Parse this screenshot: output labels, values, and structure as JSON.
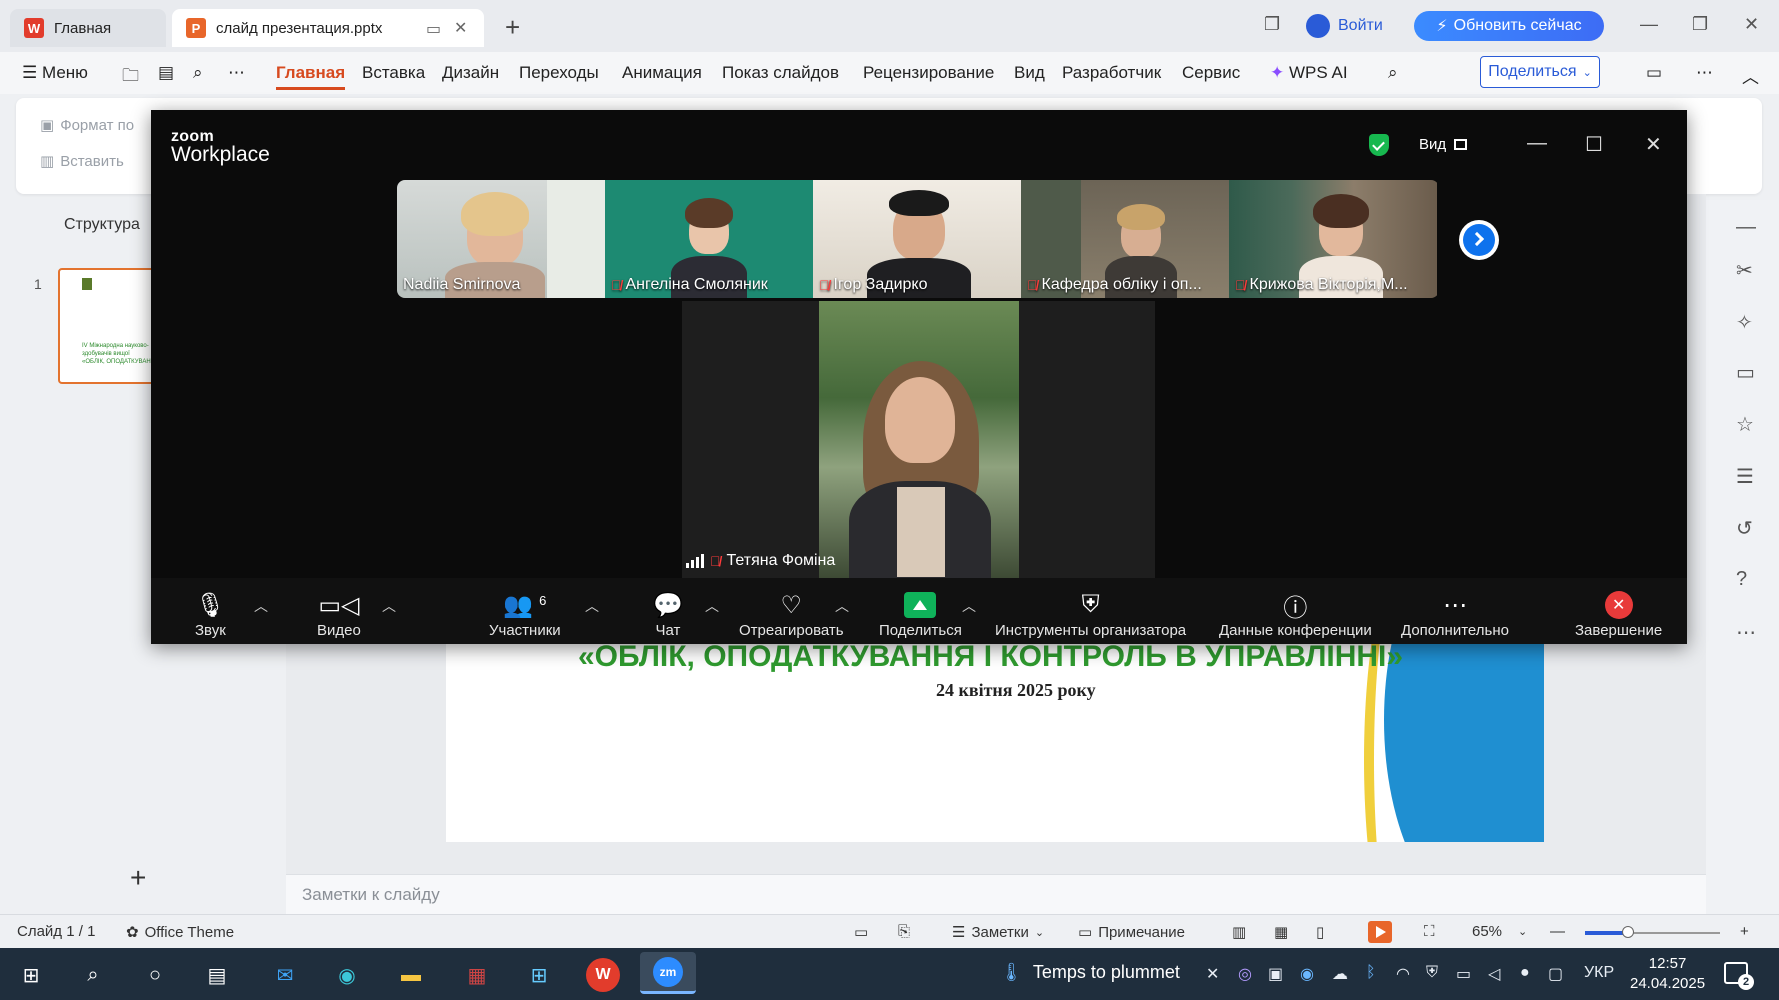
{
  "wps": {
    "tabs": [
      {
        "label": "Главная"
      },
      {
        "label": "слайд презентация.pptx"
      }
    ],
    "login": "Войти",
    "upgrade": "Обновить сейчас",
    "menu_label": "Меню",
    "menu": [
      "Главная",
      "Вставка",
      "Дизайн",
      "Переходы",
      "Анимация",
      "Показ слайдов",
      "Рецензирование",
      "Вид",
      "Разработчик",
      "Сервис",
      "WPS AI"
    ],
    "share": "Поделиться",
    "ribbon": {
      "format": "Формат по",
      "paste": "Вставить"
    },
    "structure": "Структура",
    "slide_number": "1",
    "slide": {
      "title": "«ОБЛІК, ОПОДАТКУВАННЯ І КОНТРОЛЬ В УПРАВЛІННІ»",
      "date": "24 квітня 2025 року",
      "thumb_text": "IV Міжнародна науково- здобувачів вищої «ОБЛІК, ОПОДАТКУВАН"
    },
    "notes_placeholder": "Заметки к слайду",
    "status": {
      "slide_count": "Слайд 1 / 1",
      "theme": "Office Theme",
      "notes": "Заметки",
      "comment": "Примечание",
      "zoom": "65%"
    }
  },
  "zoom": {
    "brand_top": "zoom",
    "brand_bottom": "Workplace",
    "view_label": "Вид",
    "participants": [
      {
        "name": "Nadiia Smirnova",
        "muted": false
      },
      {
        "name": "Ангеліна Смоляник",
        "muted": true
      },
      {
        "name": "Ігор Задирко",
        "muted": true
      },
      {
        "name": "Кафедра обліку і оп...",
        "muted": true
      },
      {
        "name": "Крижова Вікторія,М...",
        "muted": true
      }
    ],
    "speaker": "Тетяна Фоміна",
    "controls": {
      "audio": "Звук",
      "video": "Видео",
      "participants": "Участники",
      "participants_count": "6",
      "chat": "Чат",
      "react": "Отреагировать",
      "share": "Поделиться",
      "host_tools": "Инструменты организатора",
      "meeting_info": "Данные конференции",
      "more": "Дополнительно",
      "end": "Завершение"
    }
  },
  "taskbar": {
    "weather": "Temps to plummet",
    "lang": "УКР",
    "time": "12:57",
    "date": "24.04.2025",
    "notifications": "2"
  },
  "colors": {
    "wps_accent": "#d74a1f",
    "zoom_blue": "#0e72ed",
    "zoom_green": "#0fb25a",
    "end_red": "#e83a3a",
    "slide_green": "#2f9a2f"
  }
}
